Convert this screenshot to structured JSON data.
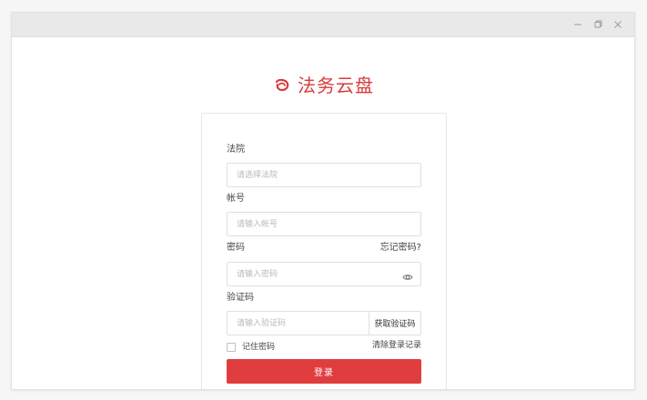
{
  "app": {
    "title": "法务云盘",
    "brand_color": "#d93b3b",
    "window_controls": [
      "minimize-icon",
      "restore-icon",
      "close-icon"
    ]
  },
  "form": {
    "court": {
      "label": "法院",
      "value": "",
      "placeholder": "请选择法院"
    },
    "account": {
      "label": "帐号",
      "value": "",
      "placeholder": "请输入帐号"
    },
    "password": {
      "label": "密码",
      "value": "",
      "placeholder": "请输入密码",
      "forgot_label": "忘记密码?",
      "visibility_icon": "eye-icon"
    },
    "captcha": {
      "label": "验证码",
      "value": "",
      "placeholder": "请输入验证码",
      "get_code_label": "获取验证码"
    },
    "remember": {
      "label": "记住密码",
      "checked": false
    },
    "clear_label": "清除登录记录",
    "login_label": "登录",
    "login_color": "#e03d3f"
  }
}
